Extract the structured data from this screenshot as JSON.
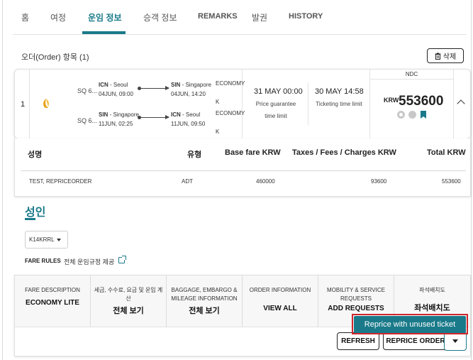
{
  "tabs": [
    {
      "label": "홈",
      "active": false
    },
    {
      "label": "여정",
      "active": false
    },
    {
      "label": "운임 정보",
      "active": true
    },
    {
      "label": "승객 정보",
      "active": false
    },
    {
      "label": "REMARKS",
      "active": false
    },
    {
      "label": "발권",
      "active": false
    },
    {
      "label": "HISTORY",
      "active": false
    }
  ],
  "order_section": {
    "title": "오더(Order) 항목 (1)",
    "delete_label": "삭제"
  },
  "order": {
    "row_number": "1",
    "segments": [
      {
        "flight_no": "SQ 6...",
        "from_code": "ICN",
        "from_city": " - Seoul",
        "dep": "04JUN, 09:00",
        "to_code": "SIN",
        "to_city": " - Singapore",
        "arr": "04JUN, 14:20",
        "cabin_line1": "ECONOMY",
        "cabin_line2": "K"
      },
      {
        "flight_no": "SQ 6...",
        "from_code": "SIN",
        "from_city": " - Singapore",
        "dep": "11JUN, 02:25",
        "to_code": "ICN",
        "to_city": " - Seoul",
        "arr": "11JUN, 09:50",
        "cabin_line1": "ECONOMY",
        "cabin_line2": "K"
      }
    ],
    "price_guarantee_time": "31 MAY 00:00",
    "price_guarantee_label_1": "Price guarantee",
    "price_guarantee_label_2": "time limit",
    "ticketing_time": "30 MAY 14:58",
    "ticketing_label": "Ticketing time limit",
    "ndc_label": "NDC",
    "currency": "KRW",
    "total_amount": "553600",
    "accent_color": "#1a7a8a"
  },
  "price_table": {
    "headers": [
      "성명",
      "유형",
      "Base fare KRW",
      "Taxes / Fees / Charges KRW",
      "Total KRW"
    ],
    "row": {
      "name": "TEST, REPRICEORDER",
      "type": "ADT",
      "base": "460000",
      "taxes": "93600",
      "total": "553600"
    }
  },
  "passenger_type_title": "성인",
  "fare_basis_select": "K14KRRL",
  "fare_rules": {
    "label": "FARE RULES",
    "link": "전체 운임규정 제공"
  },
  "info_columns": [
    {
      "title": "FARE DESCRIPTION",
      "value": "ECONOMY LITE"
    },
    {
      "title": "세금, 수수료, 요금 및 운임 계산",
      "value": "전체 보기"
    },
    {
      "title": "BAGGAGE, EMBARGO & MILEAGE INFORMATION",
      "value": "전체 보기"
    },
    {
      "title": "ORDER INFORMATION",
      "value": "VIEW ALL"
    },
    {
      "title": "MOBILITY & SERVICE REQUESTS",
      "value": "ADD REQUESTS"
    },
    {
      "title": "좌석배치도",
      "value": "좌석배치도"
    }
  ],
  "actions": {
    "reprice_unused": "Reprice with unused ticket",
    "refresh": "REFRESH",
    "reprice_order": "REPRICE ORDER"
  },
  "icons": [
    "trash-icon",
    "airline-logo-icon",
    "gear-icon",
    "circle-icon",
    "bookmark-icon",
    "chevron-up-icon",
    "caret-down-icon",
    "external-link-icon"
  ]
}
